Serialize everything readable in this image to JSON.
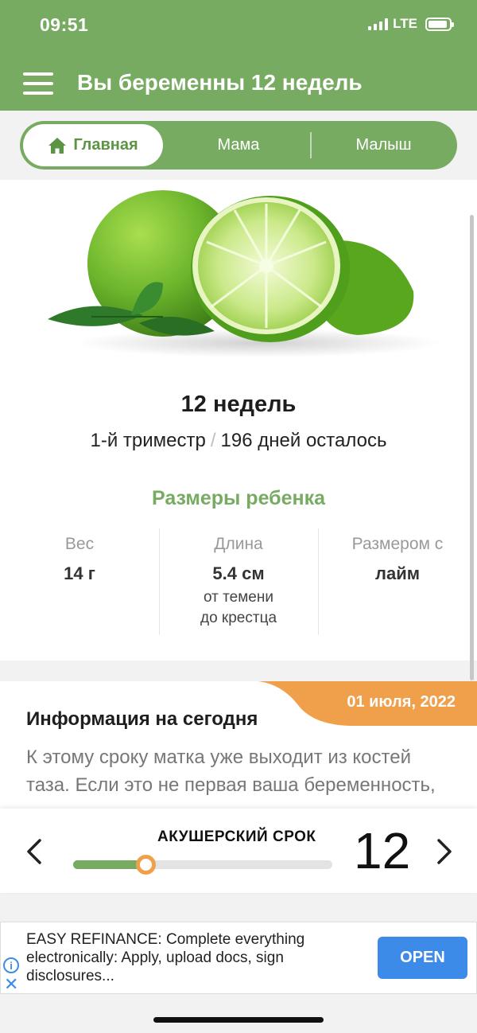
{
  "status_bar": {
    "time": "09:51",
    "network": "LTE"
  },
  "header": {
    "menu_icon": "hamburger-menu-icon",
    "title": "Вы беременны 12 недель"
  },
  "tabs": [
    {
      "label": "Главная",
      "icon": "home-icon",
      "active": true
    },
    {
      "label": "Мама",
      "active": false
    },
    {
      "label": "Малыш",
      "active": false
    }
  ],
  "week": {
    "title": "12 недель",
    "trimester": "1-й триместр",
    "separator": "/",
    "days_left": "196 дней осталось"
  },
  "baby_sizes": {
    "title": "Размеры ребенка",
    "stats": [
      {
        "label": "Вес",
        "value": "14 г",
        "note_line1": "",
        "note_line2": ""
      },
      {
        "label": "Длина",
        "value": "5.4 см",
        "note_line1": "от темени",
        "note_line2": "до крестца"
      },
      {
        "label": "Размером с",
        "value": "лайм",
        "note_line1": "",
        "note_line2": ""
      }
    ]
  },
  "info": {
    "date": "01 июля, 2022",
    "title": "Информация на сегодня",
    "text": "К этому сроку матка уже выходит из костей таза. Если это не первая ваша беременность,"
  },
  "term_selector": {
    "label": "АКУШЕРСКИЙ СРОК",
    "week_number": "12",
    "progress_fraction": 0.28,
    "prev_icon": "chevron-left-icon",
    "next_icon": "chevron-right-icon"
  },
  "ad": {
    "text": "EASY REFINANCE: Complete everything electronically: Apply, upload docs, sign disclosures...",
    "button_label": "OPEN",
    "info_icon": "info-icon",
    "close_icon": "close-icon"
  },
  "colors": {
    "brand_green": "#78ab62",
    "accent_orange": "#f0a04b",
    "ad_blue": "#3d8be8"
  }
}
